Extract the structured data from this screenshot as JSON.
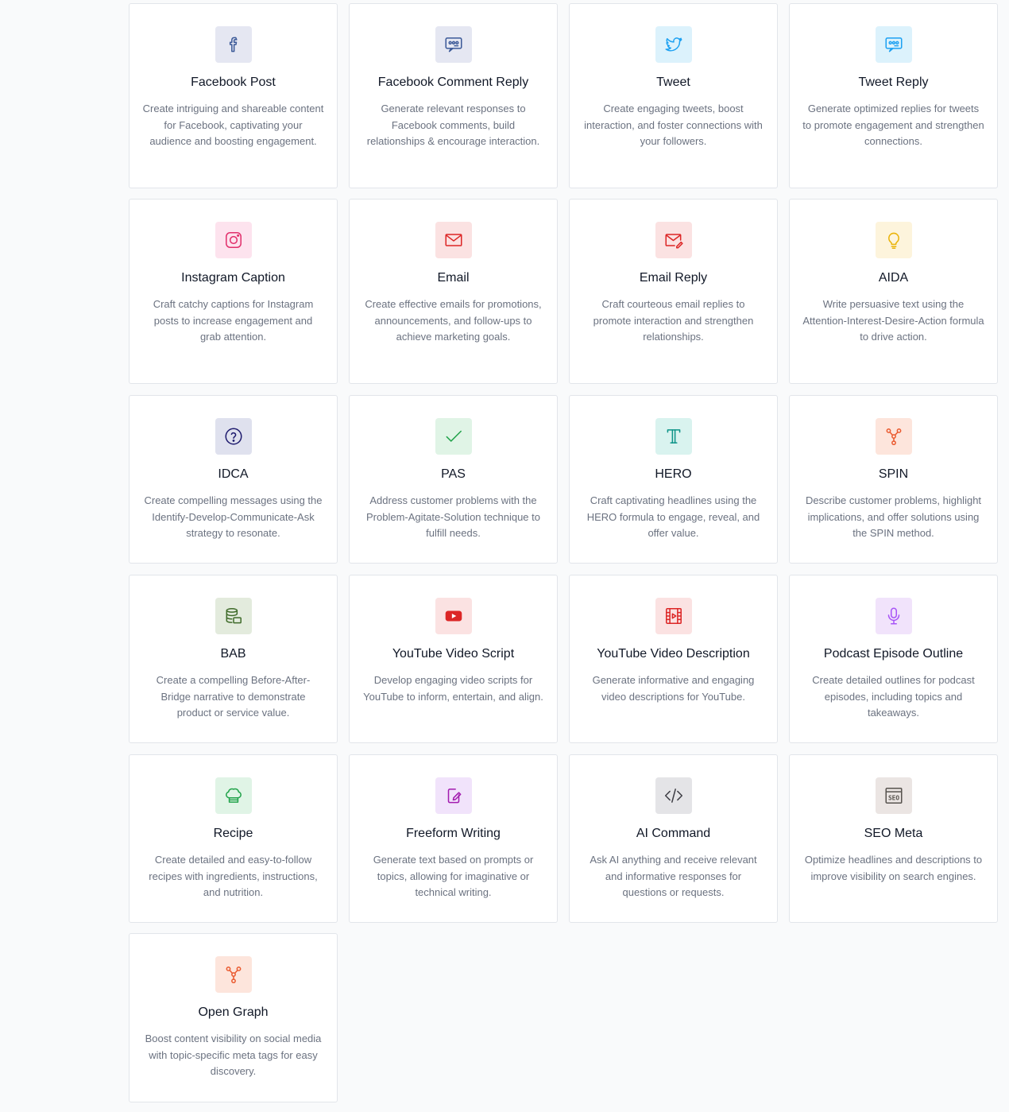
{
  "cards": [
    {
      "title": "Facebook Post",
      "desc": "Create intriguing and shareable content for Facebook, captivating your audience and boosting engagement.",
      "icon": "facebook-icon",
      "bg": "#e5e7f2",
      "fg": "#3b5998"
    },
    {
      "title": "Facebook Comment Reply",
      "desc": "Generate relevant responses to Facebook comments, build relationships & encourage interaction.",
      "icon": "comment-reply-icon",
      "bg": "#e5e7f2",
      "fg": "#3b5998"
    },
    {
      "title": "Tweet",
      "desc": "Create engaging tweets, boost interaction, and foster connections with your followers.",
      "icon": "twitter-icon",
      "bg": "#dcf2fc",
      "fg": "#1da1f2"
    },
    {
      "title": "Tweet Reply",
      "desc": "Generate optimized replies for tweets to promote engagement and strengthen connections.",
      "icon": "tweet-reply-icon",
      "bg": "#dcf2fc",
      "fg": "#1da1f2"
    },
    {
      "title": "Instagram Caption",
      "desc": "Craft catchy captions for Instagram posts to increase engagement and grab attention.",
      "icon": "instagram-icon",
      "bg": "#fde3ee",
      "fg": "#e1306c"
    },
    {
      "title": "Email",
      "desc": "Create effective emails for promotions, announcements, and follow-ups to achieve marketing goals.",
      "icon": "mail-icon",
      "bg": "#fbe2e2",
      "fg": "#dc2626"
    },
    {
      "title": "Email Reply",
      "desc": "Craft courteous email replies to promote interaction and strengthen relationships.",
      "icon": "mail-reply-icon",
      "bg": "#fbe2e2",
      "fg": "#dc2626"
    },
    {
      "title": "AIDA",
      "desc": "Write persuasive text using the Attention-Interest-Desire-Action formula to drive action.",
      "icon": "lightbulb-icon",
      "bg": "#fdf4dc",
      "fg": "#eab308"
    },
    {
      "title": "IDCA",
      "desc": "Create compelling messages using the Identify-Develop-Communicate-Ask strategy to resonate.",
      "icon": "question-circle-icon",
      "bg": "#dfe1ee",
      "fg": "#1e1b6e"
    },
    {
      "title": "PAS",
      "desc": "Address customer problems with the Problem-Agitate-Solution technique to fulfill needs.",
      "icon": "check-icon",
      "bg": "#e0f4e6",
      "fg": "#22a34b"
    },
    {
      "title": "HERO",
      "desc": "Craft captivating headlines using the HERO formula to engage, reveal, and offer value.",
      "icon": "typography-icon",
      "bg": "#d9f3ef",
      "fg": "#0d9488"
    },
    {
      "title": "SPIN",
      "desc": "Describe customer problems, highlight implications, and offer solutions using the SPIN method.",
      "icon": "nodes-icon",
      "bg": "#fde5dc",
      "fg": "#ea5a2f"
    },
    {
      "title": "BAB",
      "desc": "Create a compelling Before-After-Bridge narrative to demonstrate product or service value.",
      "icon": "database-stack-icon",
      "bg": "#e3ebdd",
      "fg": "#3f6b2a"
    },
    {
      "title": "YouTube Video Script",
      "desc": "Develop engaging video scripts for YouTube to inform, entertain, and align.",
      "icon": "youtube-icon",
      "bg": "#fbe2e2",
      "fg": "#dc2626"
    },
    {
      "title": "YouTube Video Description",
      "desc": "Generate informative and engaging video descriptions for YouTube.",
      "icon": "film-icon",
      "bg": "#fbe2e2",
      "fg": "#dc2626"
    },
    {
      "title": "Podcast Episode Outline",
      "desc": "Create detailed outlines for podcast episodes, including topics and takeaways.",
      "icon": "microphone-icon",
      "bg": "#f1e3fb",
      "fg": "#a855f7"
    },
    {
      "title": "Recipe",
      "desc": "Create detailed and easy-to-follow recipes with ingredients, instructions, and nutrition.",
      "icon": "chef-hat-icon",
      "bg": "#e0f4e6",
      "fg": "#22a34b"
    },
    {
      "title": "Freeform Writing",
      "desc": "Generate text based on prompts or topics, allowing for imaginative or technical writing.",
      "icon": "writing-icon",
      "bg": "#f1e3fb",
      "fg": "#a21caf"
    },
    {
      "title": "AI Command",
      "desc": "Ask AI anything and receive relevant and informative responses for questions or requests.",
      "icon": "code-icon",
      "bg": "#e4e4e7",
      "fg": "#3f3f46"
    },
    {
      "title": "SEO Meta",
      "desc": "Optimize headlines and descriptions to improve visibility on search engines.",
      "icon": "seo-icon",
      "bg": "#ebe5e3",
      "fg": "#57534e"
    },
    {
      "title": "Open Graph",
      "desc": "Boost content visibility on social media with topic-specific meta tags for easy discovery.",
      "icon": "nodes-icon",
      "bg": "#fde5dc",
      "fg": "#ea5a2f"
    }
  ]
}
